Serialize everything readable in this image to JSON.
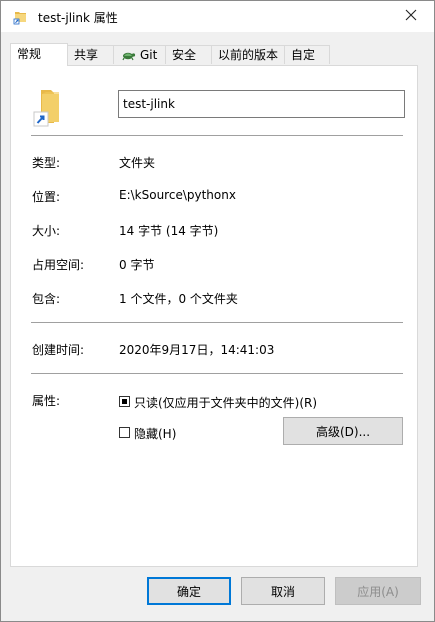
{
  "window": {
    "title": "test-jlink 属性"
  },
  "tabs": [
    {
      "label": "常规",
      "active": true
    },
    {
      "label": "共享"
    },
    {
      "label": "Git",
      "icon": "tortoise-git-icon"
    },
    {
      "label": "安全"
    },
    {
      "label": "以前的版本"
    },
    {
      "label": "自定义"
    }
  ],
  "general": {
    "name_value": "test-jlink",
    "rows": [
      {
        "label": "类型:",
        "value": "文件夹"
      },
      {
        "label": "位置:",
        "value": "E:\\kSource\\pythonx"
      },
      {
        "label": "大小:",
        "value": "14 字节 (14 字节)"
      },
      {
        "label": "占用空间:",
        "value": "0 字节"
      },
      {
        "label": "包含:",
        "value": "1 个文件，0 个文件夹"
      }
    ],
    "created": {
      "label": "创建时间:",
      "value": "2020年9月17日，14:41:03"
    },
    "attributes": {
      "label": "属性:",
      "readonly_label": "只读(仅应用于文件夹中的文件)(R)",
      "readonly_state": "indeterminate",
      "hidden_label": "隐藏(H)",
      "hidden_checked": false,
      "advanced_button": "高级(D)..."
    }
  },
  "footer": {
    "ok": "确定",
    "cancel": "取消",
    "apply": "应用(A)"
  },
  "colors": {
    "accent": "#0078d7",
    "folder": "#e8b94a",
    "folder_light": "#f6d77e",
    "shortcut_blue": "#1e66c8"
  }
}
